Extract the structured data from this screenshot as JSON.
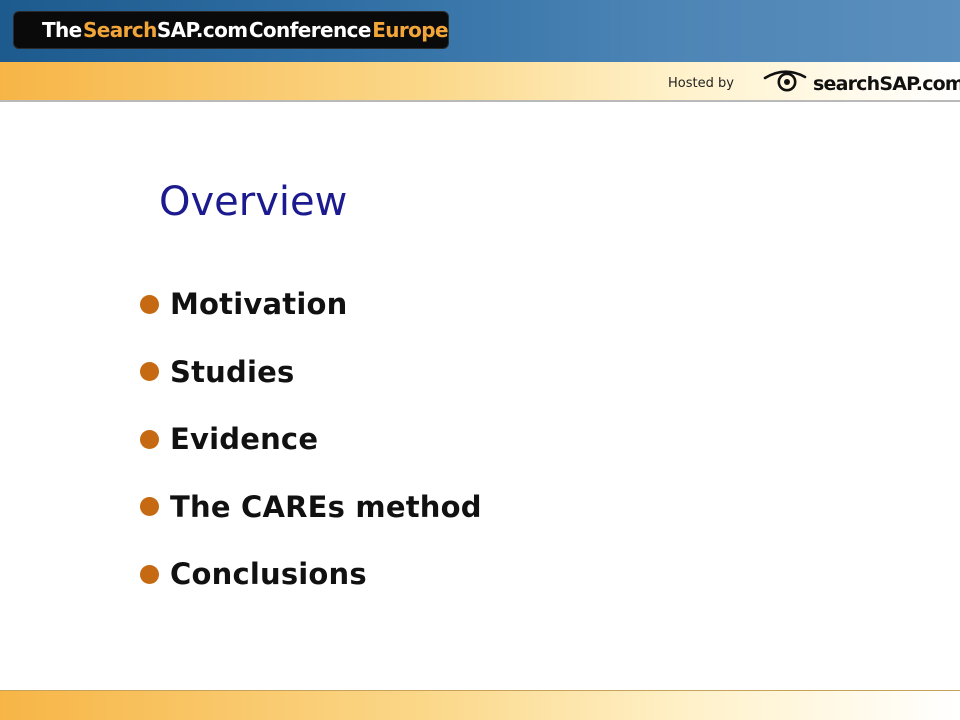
{
  "header": {
    "badge": {
      "part1": "The",
      "part2": "Search",
      "part3": "SAP.com",
      "part4": "Conference",
      "part5": "Europe"
    },
    "hosted_by": "Hosted by",
    "logo_text": "searchSAP.com",
    "logo_icon": "eye-icon"
  },
  "slide": {
    "title": "Overview",
    "bullets": [
      "Motivation",
      "Studies",
      "Evidence",
      "The CAREs method",
      "Conclusions"
    ]
  },
  "colors": {
    "title": "#1b1b8f",
    "bullet_dot": "#c56a12",
    "badge_accent": "#f2a63a",
    "top_band": "#2f6ea3",
    "yellow_band": "#f7b546"
  }
}
